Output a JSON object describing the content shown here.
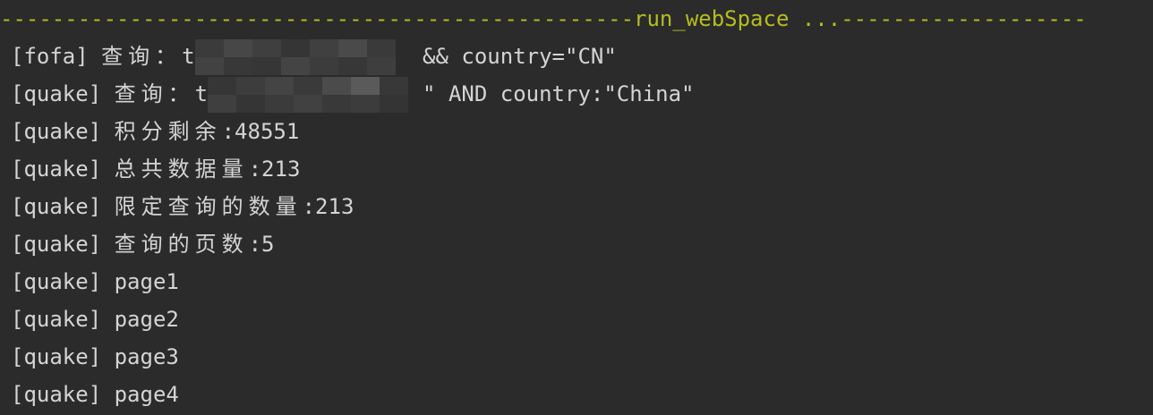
{
  "header": {
    "left_dashes": "-------------------------------------------------",
    "title": "run_webSpace ...",
    "right_dashes": "-------------------"
  },
  "lines": [
    {
      "prefix": "[fofa] ",
      "label": "查询：",
      "pre_redact": "t",
      "post_redact": " && country=\"CN\""
    },
    {
      "prefix": "[quake] ",
      "label": "查询：",
      "pre_redact": "t",
      "post_redact": "\" AND country:\"China\""
    },
    {
      "prefix": "[quake] ",
      "label": "积分剩余",
      "value": ":48551"
    },
    {
      "prefix": "[quake] ",
      "label": "总共数据量",
      "value": ":213"
    },
    {
      "prefix": "[quake] ",
      "label": "限定查询的数量",
      "value": ":213"
    },
    {
      "prefix": "[quake] ",
      "label": "查询的页数",
      "value": ":5"
    },
    {
      "prefix": "[quake] ",
      "text": "page1"
    },
    {
      "prefix": "[quake] ",
      "text": "page2"
    },
    {
      "prefix": "[quake] ",
      "text": "page3"
    },
    {
      "prefix": "[quake] ",
      "text": "page4"
    }
  ],
  "colors": {
    "background": "#2b2b2b",
    "text": "#d4d4d4",
    "header": "#b5bd1e",
    "redaction_dark": "#3a3a3a",
    "redaction_mid": "#474747",
    "redaction_light": "#5a5a5a"
  }
}
